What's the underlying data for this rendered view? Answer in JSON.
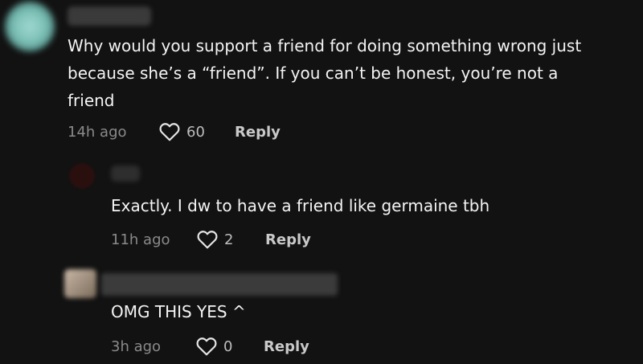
{
  "comments": [
    {
      "text": "Why would you support a friend for doing something wrong just because she’s a “friend”. If you can’t be honest, you’re not a friend",
      "time": "14h ago",
      "likes": "60",
      "reply_label": "Reply"
    },
    {
      "text": "Exactly. I dw to have a friend like germaine tbh",
      "time": "11h ago",
      "likes": "2",
      "reply_label": "Reply"
    },
    {
      "text": "OMG THIS YES ^",
      "time": "3h ago",
      "likes": "0",
      "reply_label": "Reply"
    }
  ],
  "icons": {
    "like": "heart-outline-icon"
  },
  "colors": {
    "background": "#121212",
    "text": "#f4f4f4",
    "muted": "#8a8a8a"
  }
}
